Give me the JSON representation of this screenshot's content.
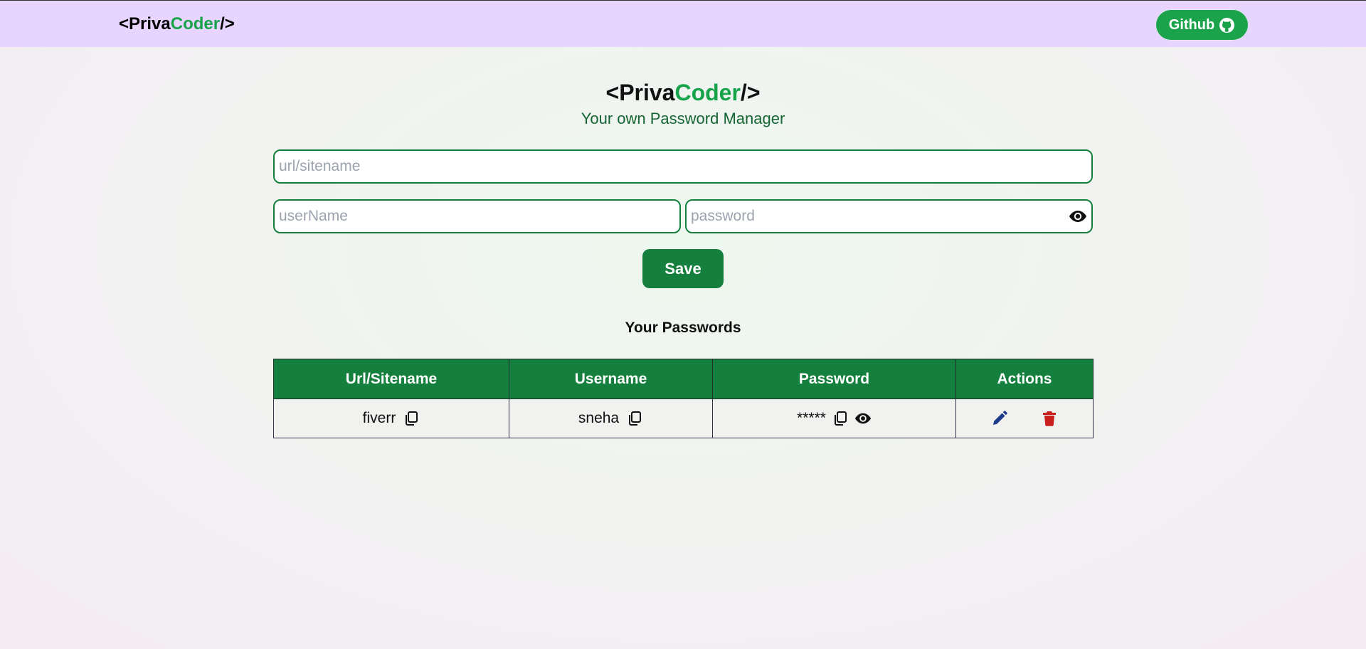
{
  "navbar": {
    "logo": {
      "open": "<",
      "part1": "Priva",
      "part2": "Coder",
      "close": "/>"
    },
    "github_label": "Github"
  },
  "hero": {
    "logo": {
      "open": "<",
      "part1": "Priva",
      "part2": "Coder",
      "close": "/>"
    },
    "tagline": "Your own Password Manager"
  },
  "form": {
    "url_placeholder": "url/sitename",
    "username_placeholder": "userName",
    "password_placeholder": "password",
    "save_label": "Save"
  },
  "passwords": {
    "title": "Your Passwords",
    "columns": [
      "Url/Sitename",
      "Username",
      "Password",
      "Actions"
    ],
    "rows": [
      {
        "site": "fiverr",
        "username": "sneha",
        "password": "*****"
      }
    ]
  },
  "colors": {
    "navbar_bg": "#e8d5ff",
    "brand_green": "#16a34a",
    "primary": "#15803d",
    "edit_icon": "#1e3a8a",
    "delete_icon": "#c81e1e"
  }
}
